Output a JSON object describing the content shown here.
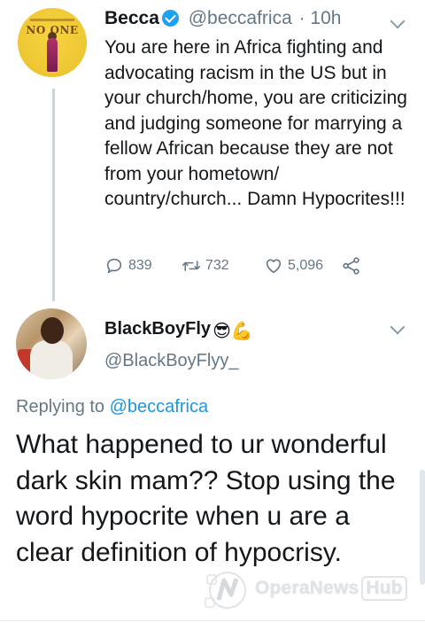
{
  "tweet1": {
    "name": "Becca",
    "handle": "@beccafrica",
    "time": "· 10h",
    "avatar_logo_text": "NO ONE",
    "text": "You are here in Africa fighting and advocating racism in the US but in your church/home, you are criticizing and judging someone for marrying a fellow African because they are not from your hometown/ country/church... Damn Hypocrites!!!",
    "reply_count": "839",
    "retweet_count": "732",
    "like_count": "5,096"
  },
  "tweet2": {
    "name": "BlackBoyFly",
    "name_emojis": "😎💪",
    "handle": "@BlackBoyFlyy_",
    "replying_prefix": "Replying to",
    "replying_to": "@beccafrica",
    "text": "What happened to ur wonderful dark skin mam?? Stop using the word hypocrite when u are a clear definition of hypocrisy."
  },
  "watermark": {
    "brand": "OperaNews",
    "brand_suffix": "Hub"
  },
  "colors": {
    "text": "#14171a",
    "secondary": "#657786",
    "link": "#1b95e0",
    "verified": "#1da1f2",
    "thread_line": "#cbd5dc"
  },
  "icons": [
    "reply-icon",
    "retweet-icon",
    "like-icon",
    "share-icon",
    "verified-badge-icon",
    "chevron-down-icon"
  ]
}
